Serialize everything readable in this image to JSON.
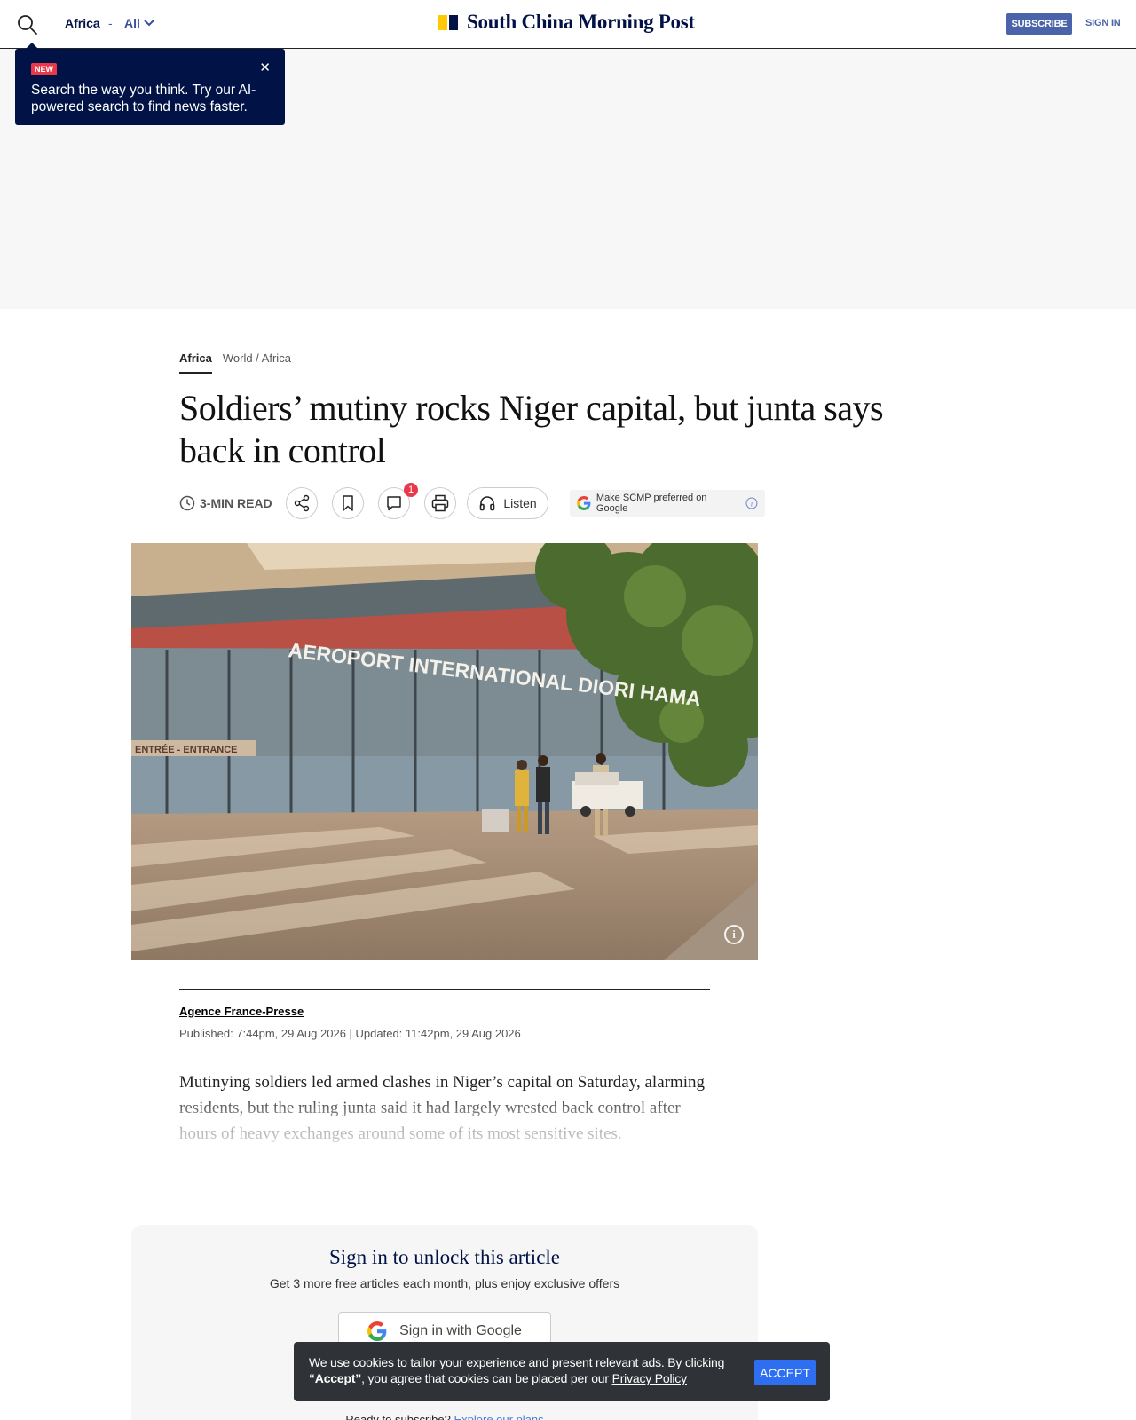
{
  "header": {
    "section": "Africa",
    "separator": "-",
    "all_label": "All",
    "logo_text": "South China Morning Post",
    "subscribe": "SUBSCRIBE",
    "sign_in": "SIGN IN"
  },
  "tooltip": {
    "badge": "NEW",
    "text": "Search the way you think. Try our AI-powered search to find news faster.",
    "close": "✕"
  },
  "article": {
    "breadcrumb": {
      "primary": "Africa",
      "secondary": "World / Africa"
    },
    "headline": "Soldiers’ mutiny rocks Niger capital, but junta says back in control",
    "read_time": "3-MIN READ",
    "comment_count": "1",
    "listen": "Listen",
    "google_pref": "Make SCMP preferred on Google",
    "image_signage": {
      "main": "AEROPORT INTERNATIONAL DIORI HAMA",
      "entrance": "ENTRÉE - ENTRANCE"
    },
    "author": "Agence France-Presse",
    "dates": "Published: 7:44pm, 29 Aug 2026 | Updated: 11:42pm, 29 Aug 2026",
    "lede": "Mutinying soldiers led armed clashes in Niger’s capital on Saturday, alarming residents, but the ruling junta said it had largely wrested back control after hours of heavy exchanges around some of its most sensitive sites."
  },
  "signin_card": {
    "title": "Sign in to unlock this article",
    "subtitle": "Get 3 more free articles each month, plus enjoy exclusive offers",
    "google_button": "Sign in with Google",
    "ready_prefix": "Ready to subscribe?",
    "ready_link": "Explore our plans"
  },
  "cookie_banner": {
    "text_1": "We use cookies to tailor your experience and present relevant ads. By clicking ",
    "accept_quote": "“Accept”",
    "text_2": ", you agree that cookies can be placed per our ",
    "policy_link": "Privacy Policy",
    "accept_button": "ACCEPT"
  },
  "colors": {
    "brand_navy": "#001246",
    "brand_yellow": "#ffca05",
    "subscribe_blue": "#4b63a9",
    "accept_blue": "#2e6ff2",
    "badge_red": "#e8394a"
  }
}
